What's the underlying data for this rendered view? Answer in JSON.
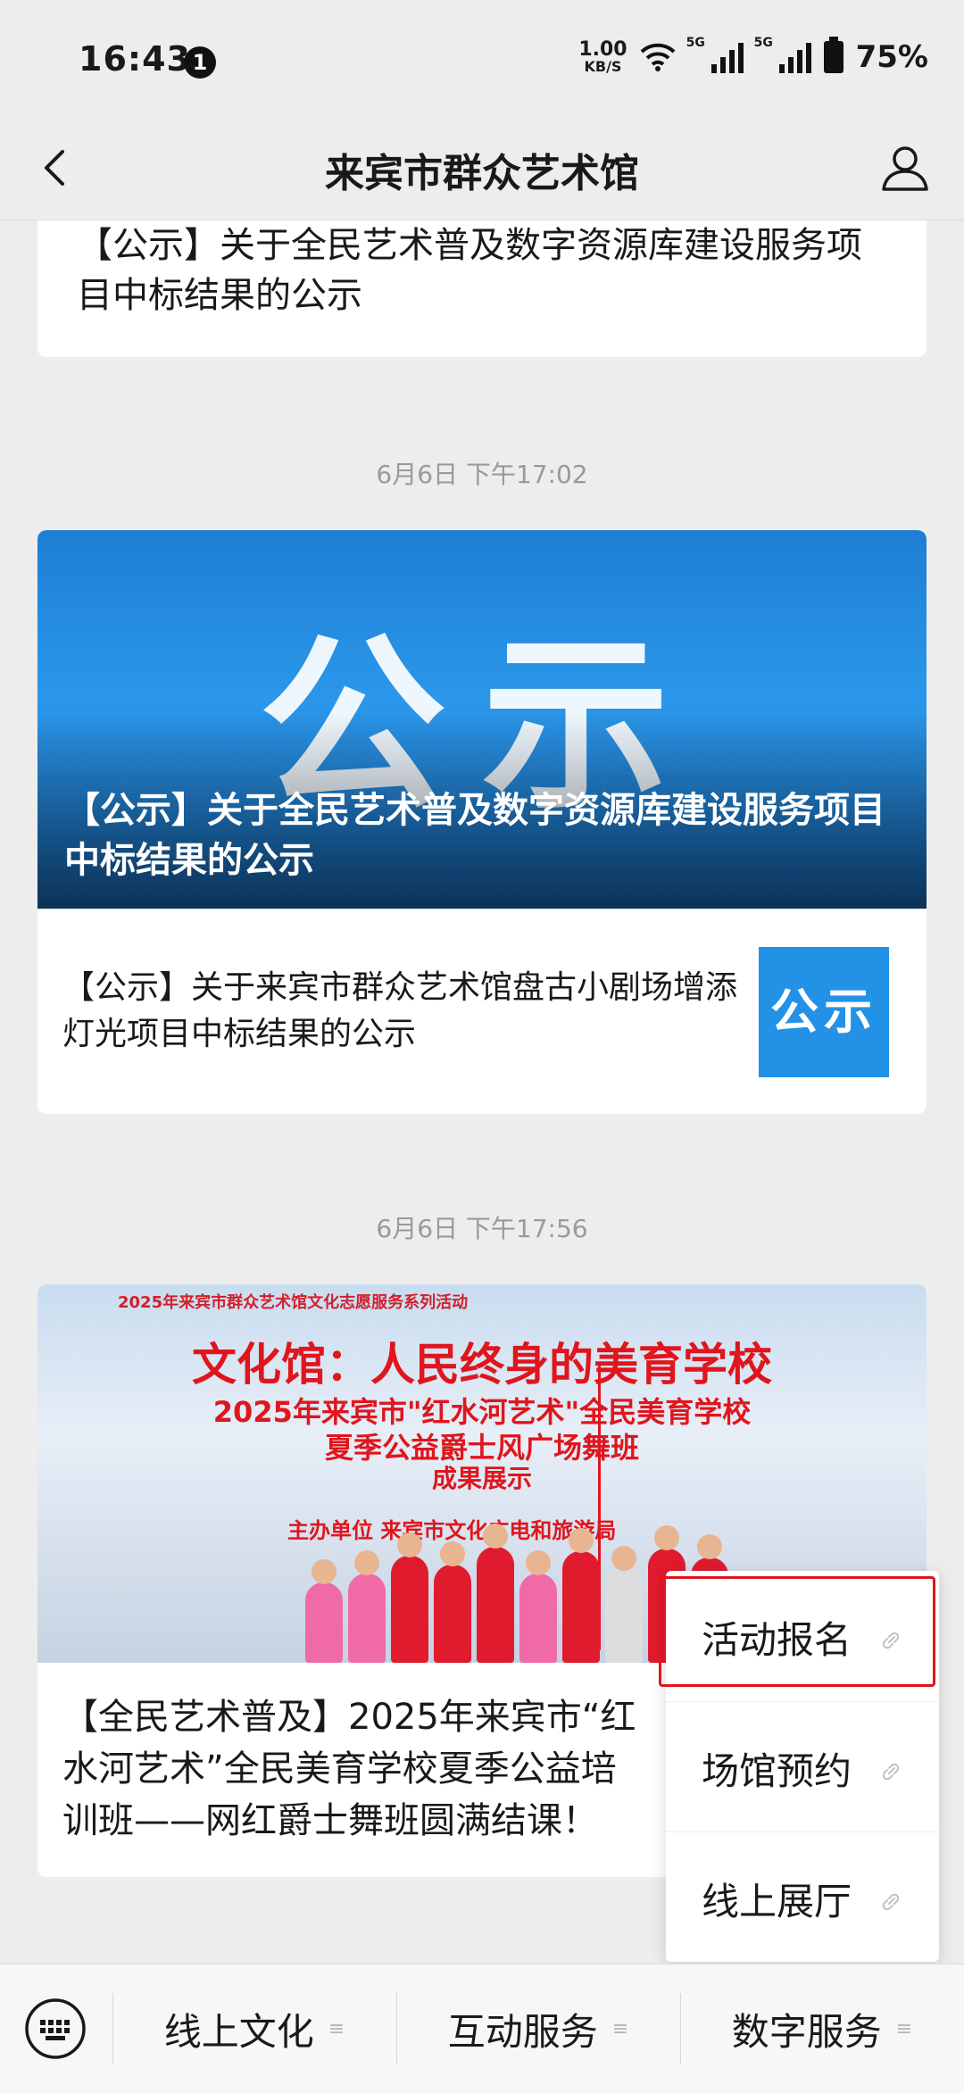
{
  "status_bar": {
    "time": "16:43",
    "notification_count": "1",
    "net_speed_value": "1.00",
    "net_speed_unit": "KB/S",
    "signal1": "5G",
    "signal2": "5G",
    "battery": "75%"
  },
  "header": {
    "title": "来宾市群众艺术馆"
  },
  "feed": {
    "card1_text": "【公示】关于全民艺术普及数字资源库建设服务项目中标结果的公示",
    "timestamp1": "6月6日 下午17:02",
    "banner1": {
      "big_text": "公示",
      "caption": "【公示】关于全民艺术普及数字资源库建设服务项目中标结果的公示"
    },
    "item1": {
      "text": "【公示】关于来宾市群众艺术馆盘古小剧场增添灯光项目中标结果的公示",
      "thumb_text": "公示"
    },
    "timestamp2": "6月6日 下午17:56",
    "poster": {
      "header": "2025年来宾市群众艺术馆文化志愿服务系列活动",
      "line1": "文化馆：人民终身的美育学校",
      "line2": "2025年来宾市\"红水河艺术\"全民美育学校",
      "line3": "夏季公益爵士风广场舞班",
      "line4": "成果展示",
      "line5": "主办单位 来宾市文化广电和旅游局"
    },
    "card3_text": "【全民艺术普及】2025年来宾市“红水河艺术”全民美育学校夏季公益培训班——网红爵士舞班圆满结课！"
  },
  "popup_menu": {
    "items": [
      "活动报名",
      "场馆预约",
      "线上展厅"
    ]
  },
  "bottom_menu": {
    "items": [
      "线上文化",
      "互动服务",
      "数字服务"
    ]
  }
}
